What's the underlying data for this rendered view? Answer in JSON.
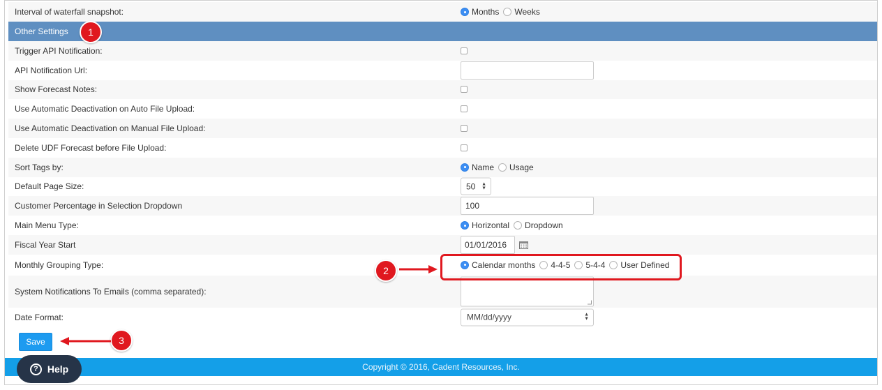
{
  "settings": {
    "waterfall": {
      "label": "Interval of waterfall snapshot:",
      "options": [
        "Months",
        "Weeks"
      ],
      "selected": "Months"
    },
    "section_title": "Other Settings",
    "trigger_api": {
      "label": "Trigger API Notification:"
    },
    "api_url": {
      "label": "API Notification Url:",
      "value": ""
    },
    "show_notes": {
      "label": "Show Forecast Notes:"
    },
    "auto_deactivation": {
      "label": "Use Automatic Deactivation on Auto File Upload:"
    },
    "manual_deactivation": {
      "label": "Use Automatic Deactivation on Manual File Upload:"
    },
    "delete_udf": {
      "label": "Delete UDF Forecast before File Upload:"
    },
    "sort_tags": {
      "label": "Sort Tags by:",
      "options": [
        "Name",
        "Usage"
      ],
      "selected": "Name"
    },
    "page_size": {
      "label": "Default Page Size:",
      "value": "50"
    },
    "customer_pct": {
      "label": "Customer Percentage in Selection Dropdown",
      "value": "100"
    },
    "menu_type": {
      "label": "Main Menu Type:",
      "options": [
        "Horizontal",
        "Dropdown"
      ],
      "selected": "Horizontal"
    },
    "fiscal_start": {
      "label": "Fiscal Year Start",
      "value": "01/01/2016"
    },
    "grouping": {
      "label": "Monthly Grouping Type:",
      "options": [
        "Calendar months",
        "4-4-5",
        "5-4-4",
        "User Defined"
      ],
      "selected": "Calendar months"
    },
    "notify_emails": {
      "label": "System Notifications To Emails (comma separated):",
      "value": ""
    },
    "date_format": {
      "label": "Date Format:",
      "value": "MM/dd/yyyy"
    }
  },
  "buttons": {
    "save": "Save",
    "help": "Help"
  },
  "footer": {
    "copyright": "Copyright © 2016, Cadent Resources, Inc."
  },
  "callouts": [
    "1",
    "2",
    "3"
  ],
  "colors": {
    "header": "#5f8fc1",
    "accent": "#1d9bf0",
    "callout": "#e0181f",
    "footer": "#149fe8"
  },
  "icons": {
    "calendar": "calendar-icon",
    "help": "question-circle-icon"
  }
}
